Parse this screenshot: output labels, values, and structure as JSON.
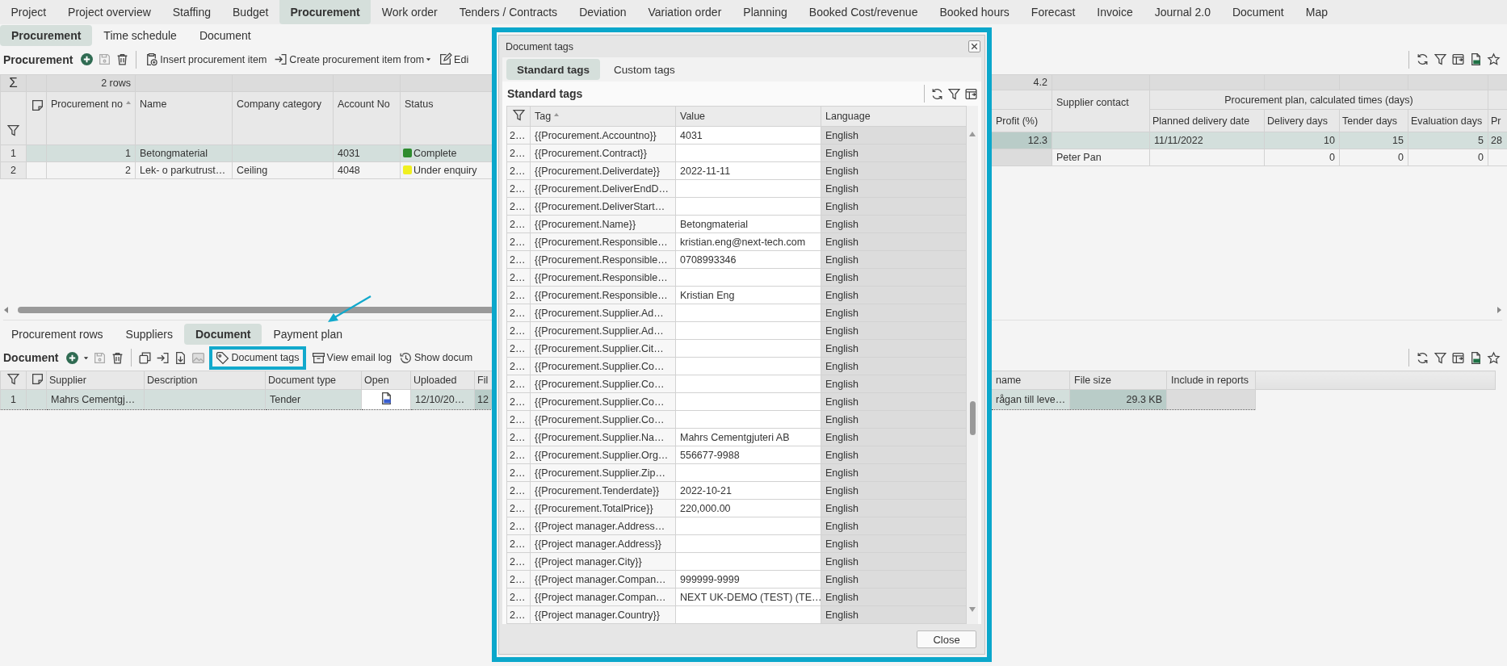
{
  "nav_tabs": [
    {
      "label": "Project",
      "selected": false
    },
    {
      "label": "Project overview",
      "selected": false
    },
    {
      "label": "Staffing",
      "selected": false
    },
    {
      "label": "Budget",
      "selected": false
    },
    {
      "label": "Procurement",
      "selected": true
    },
    {
      "label": "Work order",
      "selected": false
    },
    {
      "label": "Tenders / Contracts",
      "selected": false
    },
    {
      "label": "Deviation",
      "selected": false
    },
    {
      "label": "Variation order",
      "selected": false
    },
    {
      "label": "Planning",
      "selected": false
    },
    {
      "label": "Booked Cost/revenue",
      "selected": false
    },
    {
      "label": "Booked hours",
      "selected": false
    },
    {
      "label": "Forecast",
      "selected": false
    },
    {
      "label": "Invoice",
      "selected": false
    },
    {
      "label": "Journal 2.0",
      "selected": false
    },
    {
      "label": "Document",
      "selected": false
    },
    {
      "label": "Map",
      "selected": false
    }
  ],
  "sub_tabs": [
    {
      "label": "Procurement",
      "selected": true
    },
    {
      "label": "Time schedule",
      "selected": false
    },
    {
      "label": "Document",
      "selected": false
    }
  ],
  "procurement_toolbar": {
    "title": "Procurement",
    "buttons": [
      {
        "kind": "insert",
        "label": "Insert procurement item",
        "dropdown": false
      },
      {
        "kind": "create",
        "label": "Create procurement item from",
        "dropdown": true
      },
      {
        "kind": "edit",
        "label": "Edi",
        "dropdown": false
      }
    ]
  },
  "procurement_grid": {
    "summary_symbol": "Σ",
    "row_count": "2 rows",
    "profit_total": "4.2",
    "left_columns": [
      {
        "label": "Procurement no",
        "sorted": true
      },
      {
        "label": "Name",
        "sorted": false
      },
      {
        "label": "Company category",
        "sorted": false
      },
      {
        "label": "Account No",
        "sorted": false
      },
      {
        "label": "Status",
        "sorted": false
      }
    ],
    "profit_label": "Profit (%)",
    "supplier_contact_label": "Supplier contact",
    "plan_label": "Procurement plan, calculated times (days)",
    "plan_columns": [
      "Planned delivery date",
      "Delivery days",
      "Tender days",
      "Evaluation days",
      "Pr"
    ],
    "rows": [
      {
        "selected": true,
        "index": "1",
        "no": "1",
        "name": "Betongmaterial",
        "account": "4031",
        "status": "Complete",
        "color": "#2e8b2e",
        "profit": "12.3",
        "planned": "11/11/2022",
        "delivery": "10",
        "tender": "15",
        "evaluation": "5",
        "column_pr": "28"
      },
      {
        "selected": false,
        "index": "2",
        "no": "2",
        "name": "Lek- o parkutrust…",
        "category": "Ceiling",
        "account": "4048",
        "status": "Under enquiry",
        "color": "#f0f020",
        "supplier_contact": "Peter Pan",
        "delivery": "0",
        "tender": "0",
        "evaluation": "0"
      }
    ]
  },
  "detail_tabs": [
    {
      "label": "Procurement rows",
      "selected": false
    },
    {
      "label": "Suppliers",
      "selected": false
    },
    {
      "label": "Document",
      "selected": true
    },
    {
      "label": "Payment plan",
      "selected": false
    }
  ],
  "document_toolbar": {
    "title": "Document",
    "buttons": [
      {
        "kind": "tags",
        "label": "Document tags",
        "highlighted": true
      },
      {
        "kind": "email",
        "label": "View email log",
        "highlighted": false
      },
      {
        "kind": "history",
        "label": "Show docum",
        "highlighted": false
      }
    ]
  },
  "document_grid": {
    "left_columns": [
      "Supplier",
      "Description",
      "Document type",
      "Open",
      "Uploaded",
      "Fil"
    ],
    "right_columns": [
      "name",
      "File size",
      "Include in reports"
    ],
    "rows": [
      {
        "selected": true,
        "index": "1",
        "supplier": "Mahrs Cementgj…",
        "document_type": "Tender",
        "uploaded": "12/10/20…",
        "column_fil": "12",
        "file_name": "rågan till leve…",
        "file_size": "29.3 KB"
      }
    ]
  },
  "dialog": {
    "title": "Document tags",
    "tabs": [
      {
        "label": "Standard tags",
        "selected": true
      },
      {
        "label": "Custom tags",
        "selected": false
      }
    ],
    "heading": "Standard tags",
    "columns": [
      {
        "label": "Tag",
        "sorted": true
      },
      {
        "label": "Value",
        "sorted": false
      },
      {
        "label": "Language",
        "sorted": false
      }
    ],
    "rows": [
      {
        "no": "2…",
        "tag": "{{Procurement.Accountno}}",
        "value": "4031",
        "language": "English"
      },
      {
        "no": "2…",
        "tag": "{{Procurement.Contract}}",
        "language": "English"
      },
      {
        "no": "2…",
        "tag": "{{Procurement.Deliverdate}}",
        "value": "2022-11-11",
        "language": "English"
      },
      {
        "no": "2…",
        "tag": "{{Procurement.DeliverEndD…",
        "language": "English"
      },
      {
        "no": "2…",
        "tag": "{{Procurement.DeliverStart…",
        "language": "English"
      },
      {
        "no": "2…",
        "tag": "{{Procurement.Name}}",
        "value": "Betongmaterial",
        "language": "English"
      },
      {
        "no": "2…",
        "tag": "{{Procurement.Responsible…",
        "value": "kristian.eng@next-tech.com",
        "language": "English"
      },
      {
        "no": "2…",
        "tag": "{{Procurement.Responsible…",
        "value": "0708993346",
        "language": "English"
      },
      {
        "no": "2…",
        "tag": "{{Procurement.Responsible…",
        "language": "English"
      },
      {
        "no": "2…",
        "tag": "{{Procurement.Responsible…",
        "value": "Kristian Eng",
        "language": "English"
      },
      {
        "no": "2…",
        "tag": "{{Procurement.Supplier.Ad…",
        "language": "English"
      },
      {
        "no": "2…",
        "tag": "{{Procurement.Supplier.Ad…",
        "language": "English"
      },
      {
        "no": "2…",
        "tag": "{{Procurement.Supplier.Cit…",
        "language": "English"
      },
      {
        "no": "2…",
        "tag": "{{Procurement.Supplier.Co…",
        "language": "English"
      },
      {
        "no": "2…",
        "tag": "{{Procurement.Supplier.Co…",
        "language": "English"
      },
      {
        "no": "2…",
        "tag": "{{Procurement.Supplier.Co…",
        "language": "English"
      },
      {
        "no": "2…",
        "tag": "{{Procurement.Supplier.Co…",
        "language": "English"
      },
      {
        "no": "2…",
        "tag": "{{Procurement.Supplier.Na…",
        "value": "Mahrs Cementgjuteri AB",
        "language": "English"
      },
      {
        "no": "2…",
        "tag": "{{Procurement.Supplier.Org…",
        "value": "556677-9988",
        "language": "English"
      },
      {
        "no": "2…",
        "tag": "{{Procurement.Supplier.Zip…",
        "language": "English"
      },
      {
        "no": "2…",
        "tag": "{{Procurement.Tenderdate}}",
        "value": "2022-10-21",
        "language": "English"
      },
      {
        "no": "2…",
        "tag": "{{Procurement.TotalPrice}}",
        "value": "220,000.00",
        "language": "English"
      },
      {
        "no": "2…",
        "tag": "{{Project manager.Address…",
        "language": "English"
      },
      {
        "no": "2…",
        "tag": "{{Project manager.Address}}",
        "language": "English"
      },
      {
        "no": "2…",
        "tag": "{{Project manager.City}}",
        "language": "English"
      },
      {
        "no": "2…",
        "tag": "{{Project manager.Compan…",
        "value": "999999-9999",
        "language": "English"
      },
      {
        "no": "2…",
        "tag": "{{Project manager.Compan…",
        "value": "NEXT UK-DEMO (TEST) (TE…",
        "language": "English"
      },
      {
        "no": "2…",
        "tag": "{{Project manager.Country}}",
        "language": "English"
      }
    ],
    "close_button": "Close"
  }
}
